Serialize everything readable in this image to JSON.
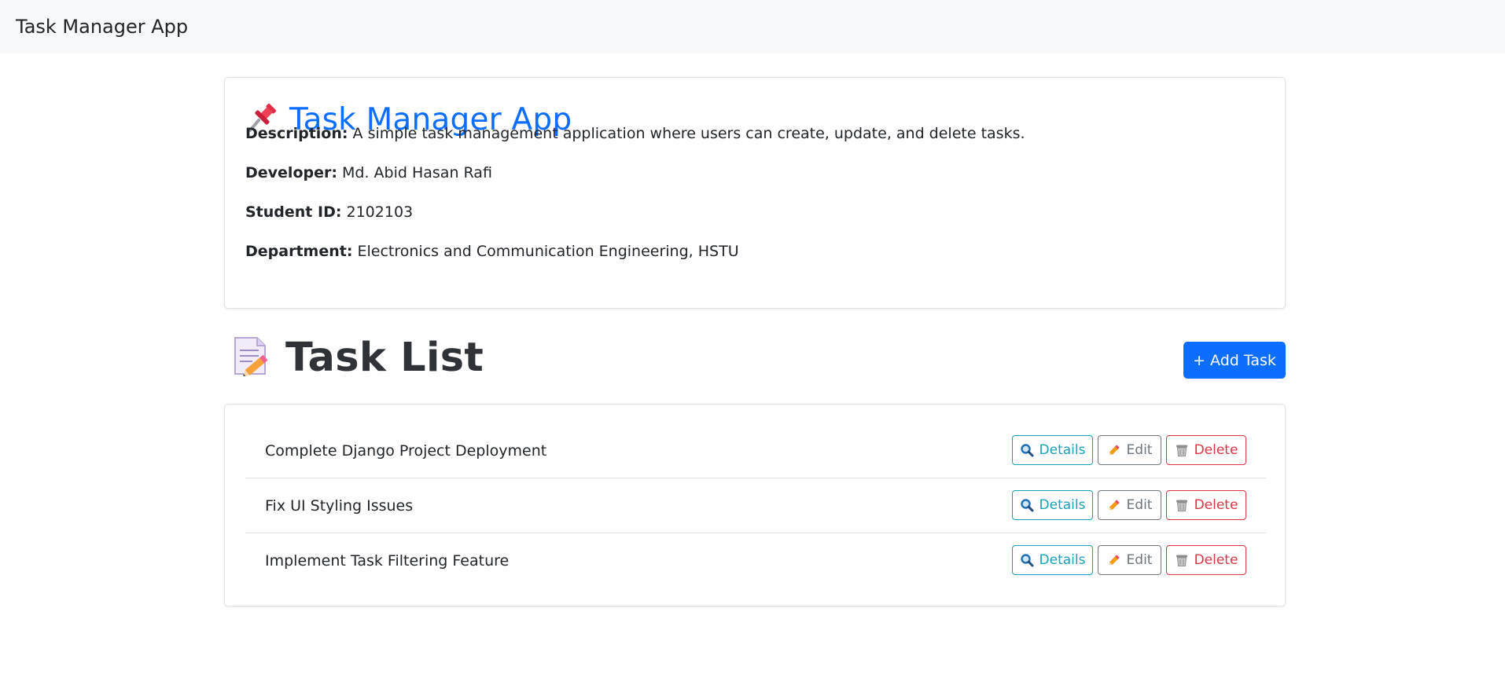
{
  "navbar": {
    "brand": "Task Manager App"
  },
  "info": {
    "title_icon": "pushpin-icon",
    "title": "Task Manager App",
    "description_label": "Description:",
    "description": "A simple task management application where users can create, update, and delete tasks.",
    "developer_label": "Developer:",
    "developer": "Md. Abid Hasan Rafi",
    "student_id_label": "Student ID:",
    "student_id": "2102103",
    "department_label": "Department:",
    "department": "Electronics and Communication Engineering, HSTU"
  },
  "task_list": {
    "heading_icon": "memo-icon",
    "heading": "Task List",
    "add_button": "+ Add Task",
    "tasks": [
      {
        "title": "Complete Django Project Deployment"
      },
      {
        "title": "Fix UI Styling Issues"
      },
      {
        "title": "Implement Task Filtering Feature"
      }
    ],
    "actions": {
      "details": "Details",
      "edit": "Edit",
      "delete": "Delete"
    }
  },
  "colors": {
    "primary": "#0d6efd",
    "info": "#17a2b8",
    "secondary": "#6c757d",
    "danger": "#dc3545",
    "navbar_bg": "#f8f9fa"
  }
}
